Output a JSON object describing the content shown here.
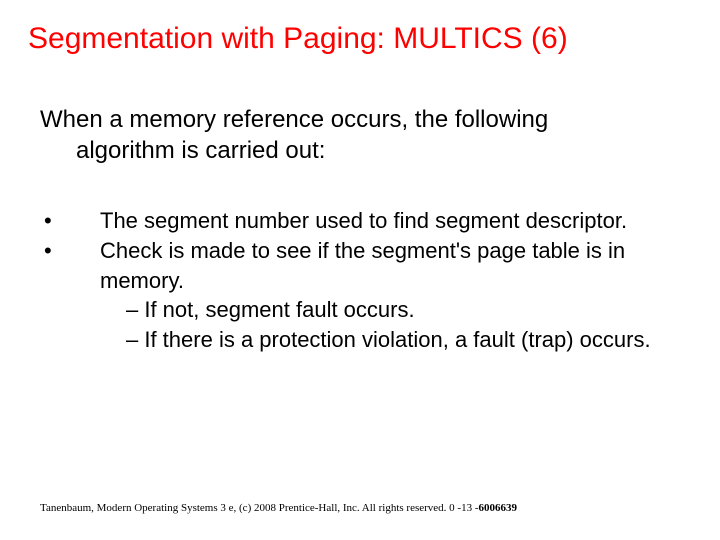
{
  "title": "Segmentation with Paging: MULTICS (6)",
  "intro_line1": "When a memory reference occurs, the following",
  "intro_line2": "algorithm is carried out:",
  "bullets": [
    {
      "mark": "•",
      "text": "The segment number used to find segment descriptor."
    },
    {
      "mark": "•",
      "text": "Check is made to see if the segment's page table is in memory.",
      "subs": [
        "– If not, segment fault occurs.",
        "– If there is a protection violation, a fault (trap) occurs."
      ]
    }
  ],
  "footer_plain": "Tanenbaum, Modern Operating Systems 3 e, (c) 2008 Prentice-Hall, Inc. All rights reserved. 0 -13 -",
  "footer_bold": "6006639"
}
